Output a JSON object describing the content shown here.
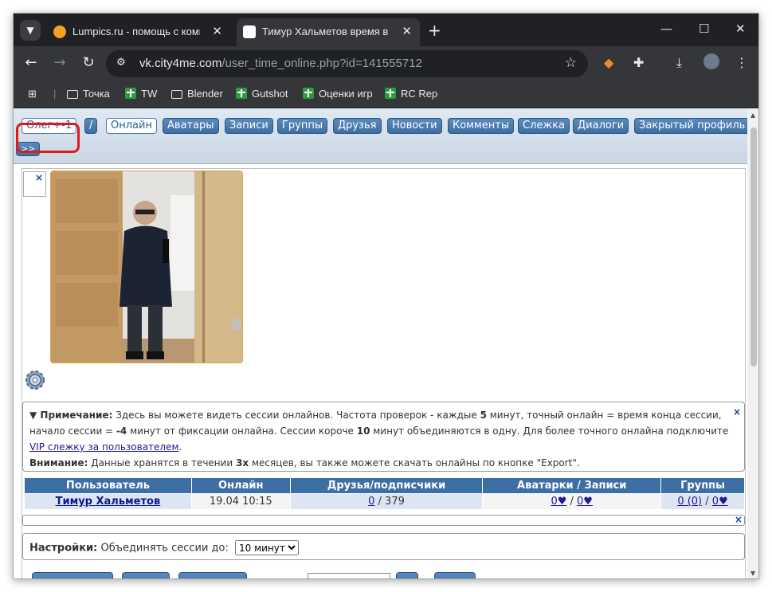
{
  "browser": {
    "tabs": [
      {
        "title": "Lumpics.ru - помощь с компью",
        "active": false,
        "favicon_color": "#f4a021"
      },
      {
        "title": "Тимур Хальметов время в сети",
        "active": true,
        "favicon_color": "#ffffff"
      }
    ],
    "url_domain": "vk.city4me.com",
    "url_path": "/user_time_online.php?id=141555712",
    "bookmarks": [
      {
        "label": "Точка",
        "icon": "folder-icon"
      },
      {
        "label": "TW",
        "icon": "green-plus-icon"
      },
      {
        "label": "Blender",
        "icon": "folder-icon"
      },
      {
        "label": "Gutshot",
        "icon": "green-plus-icon"
      },
      {
        "label": "Оценки игр",
        "icon": "green-plus-icon"
      },
      {
        "label": "RC Rep",
        "icon": "green-plus-icon"
      }
    ]
  },
  "menu": {
    "items": [
      {
        "label": "Олег+-1",
        "style": "white"
      },
      {
        "label": "/",
        "style": "blue"
      },
      {
        "label": "Онлайн",
        "style": "white"
      },
      {
        "label": "Аватары",
        "style": "blue"
      },
      {
        "label": "Записи",
        "style": "blue"
      },
      {
        "label": "Группы",
        "style": "blue"
      },
      {
        "label": "Друзья",
        "style": "blue"
      },
      {
        "label": "Новости",
        "style": "blue"
      },
      {
        "label": "Комменты",
        "style": "blue"
      },
      {
        "label": "Слежка",
        "style": "blue"
      },
      {
        "label": "Диалоги",
        "style": "blue"
      },
      {
        "label": "Закрытый профиль",
        "style": "blue"
      }
    ],
    "more": ">>"
  },
  "note": {
    "title": "▼ Примечание:",
    "text1": " Здесь вы можете видеть сессии онлайнов. Частота проверок - каждые ",
    "freq": "5",
    "text2": " минут, точный онлайн = время конца сессии, начало сессии = ",
    "offset": "-4",
    "text3": " минут от фиксации онлайна. Сессии короче ",
    "short": "10",
    "text4": " минут объединяются в одну. Для более точного онлайна подключите ",
    "link": "VIP слежку за пользователем",
    "text5": ".",
    "warn_title": "Внимание:",
    "warn1": " Данные хранятся в течении ",
    "warn_months": "3х",
    "warn2": " месяцев, вы также можете скачать онлайны по кнопке \"Export\"."
  },
  "table": {
    "headers": [
      "Пользователь",
      "Онлайн",
      "Друзья/подписчики",
      "Аватарки / Записи",
      "Группы"
    ],
    "row": {
      "user": "Тимур Хальметов",
      "online": "19.04 10:15",
      "friends_link": "0",
      "friends_rest": " / 379",
      "avatars": "0♥",
      "avatars_sep": " / ",
      "posts": "0♥",
      "groups": "0 (0)",
      "groups_sep": " / ",
      "groups2": "0♥"
    }
  },
  "settings": {
    "label": "Настройки:",
    "text": " Объединять сессии до:",
    "selected": "10 минут"
  },
  "close_glyph": "×"
}
